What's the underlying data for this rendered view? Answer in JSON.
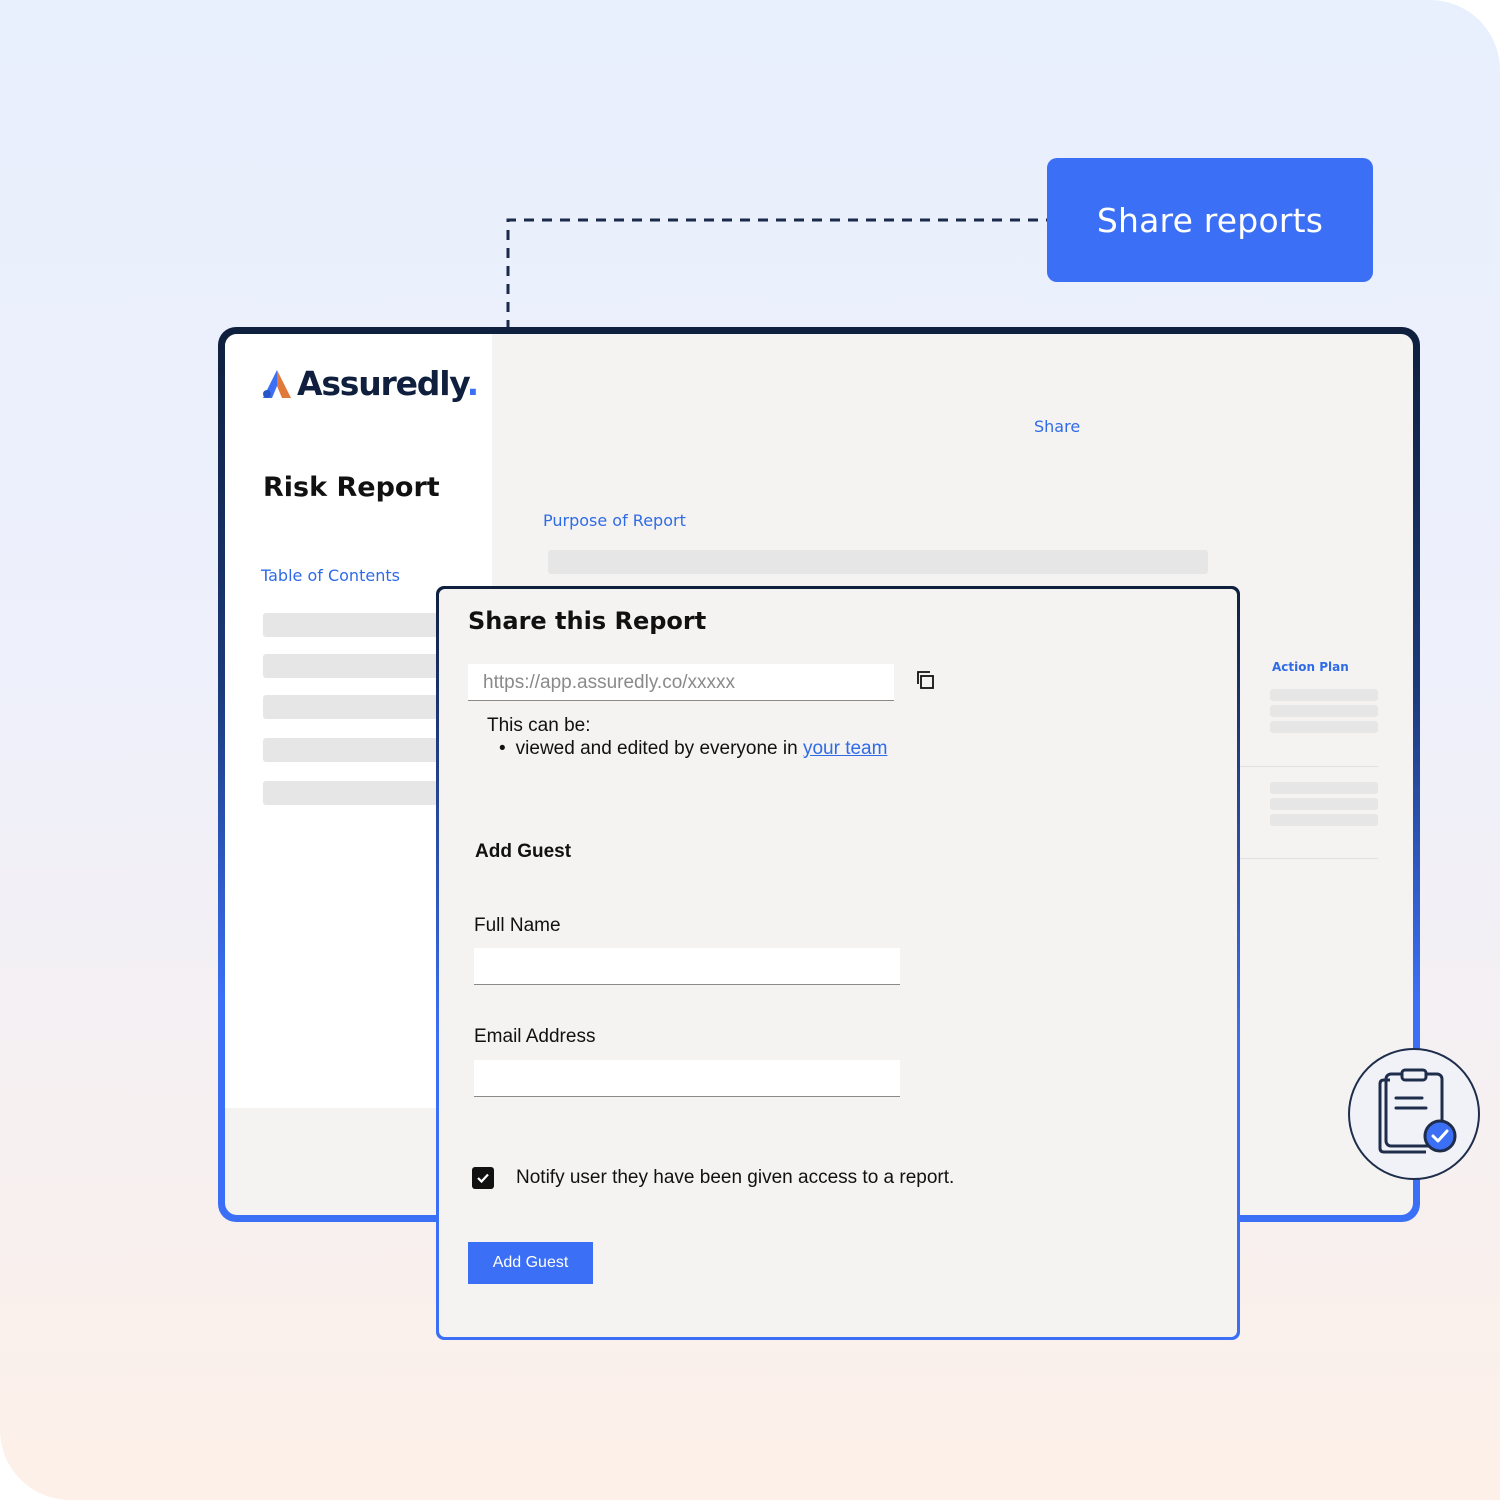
{
  "callout": {
    "label": "Share reports"
  },
  "brand": {
    "name": "Assuredly",
    "dot": ".",
    "accent_color": "#3b6ff5",
    "dark_color": "#0f1f3d"
  },
  "sidebar": {
    "report_title": "Risk Report",
    "toc_label": "Table of Contents",
    "toc_items": 5
  },
  "report": {
    "share_label": "Share",
    "purpose_label": "Purpose of Report",
    "action_plan_label": "Action Plan"
  },
  "modal": {
    "title": "Share this Report",
    "share_url": "https://app.assuredly.co/xxxxx",
    "can_be_label": "This can be:",
    "bullet_text": "viewed and edited by everyone in ",
    "bullet_link": "your team",
    "add_guest_heading": "Add Guest",
    "full_name_label": "Full Name",
    "full_name_value": "",
    "email_label": "Email Address",
    "email_value": "",
    "notify_checked": true,
    "notify_label": "Notify user they have been given access to a report.",
    "submit_label": "Add Guest"
  },
  "icons": {
    "copy": "copy-icon",
    "checkbox": "checkmark-icon",
    "badge": "clipboard-check-icon",
    "logo": "assuredly-logo-icon"
  }
}
